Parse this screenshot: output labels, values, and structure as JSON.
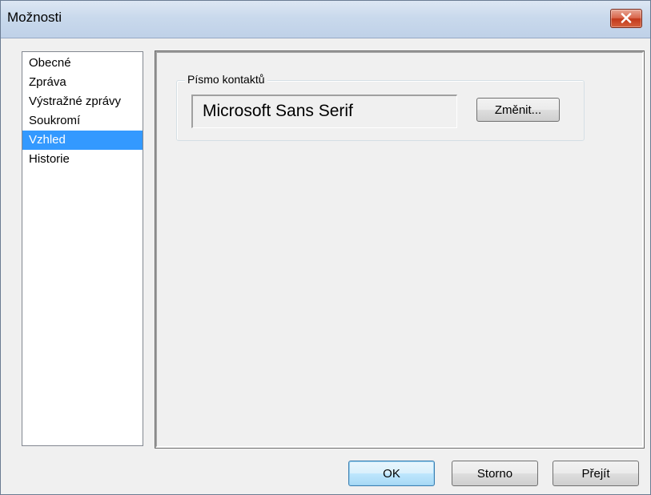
{
  "window": {
    "title": "Možnosti",
    "close_icon": "close-icon"
  },
  "sidebar": {
    "items": [
      {
        "label": "Obecné",
        "selected": false
      },
      {
        "label": "Zpráva",
        "selected": false
      },
      {
        "label": "Výstražné zprávy",
        "selected": false
      },
      {
        "label": "Soukromí",
        "selected": false
      },
      {
        "label": "Vzhled",
        "selected": true
      },
      {
        "label": "Historie",
        "selected": false
      }
    ]
  },
  "appearance": {
    "group_label": "Písmo kontaktů",
    "font_value": "Microsoft Sans Serif",
    "change_button": "Změnit..."
  },
  "footer": {
    "ok": "OK",
    "cancel": "Storno",
    "go": "Přejít"
  },
  "colors": {
    "selection": "#3399ff",
    "close_button": "#c2391b",
    "default_button_border": "#3c7fb1"
  }
}
